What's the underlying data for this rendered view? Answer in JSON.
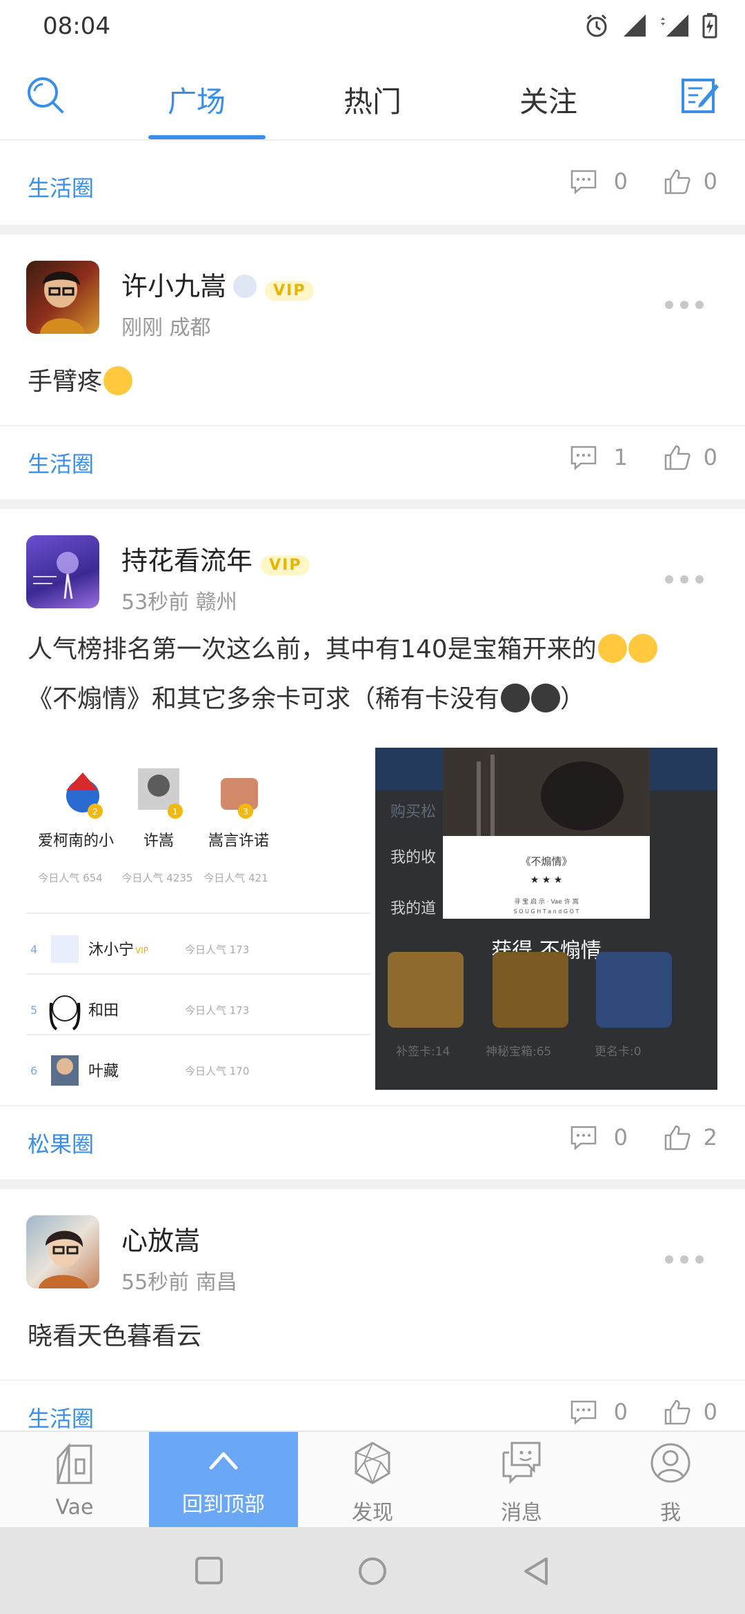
{
  "status_bar": {
    "time": "08:04",
    "network": "4G"
  },
  "top_nav": {
    "tabs": [
      {
        "label": "广场",
        "active": true
      },
      {
        "label": "热门",
        "active": false
      },
      {
        "label": "关注",
        "active": false
      }
    ],
    "search_icon": "search-icon",
    "compose_icon": "compose-icon",
    "accent": "#3b8ee6"
  },
  "first_meta": {
    "circle": "生活圈",
    "comments": "0",
    "likes": "0"
  },
  "posts": [
    {
      "name": "许小九嵩",
      "vip": "VIP",
      "time_location": "刚刚 成都",
      "text": "手臂疼",
      "circle": "生活圈",
      "comments": "1",
      "likes": "0"
    },
    {
      "name": "持花看流年",
      "vip": "VIP",
      "time_location": "53秒前 赣州",
      "text_line1": "人气榜排名第一次这么前，其中有140是宝箱开来的",
      "text_line2": "《不煽情》和其它多余卡可求（稀有卡没有",
      "text_line2_end": "）",
      "circle": "松果圈",
      "comments": "0",
      "likes": "2",
      "ranking_image": {
        "top3": [
          {
            "rank": "2",
            "name": "爱柯南的小",
            "score": "今日人气 654"
          },
          {
            "rank": "1",
            "name": "许嵩",
            "score": "今日人气 4235"
          },
          {
            "rank": "3",
            "name": "嵩言许诺",
            "score": "今日人气 421"
          }
        ],
        "rows": [
          {
            "rank": "4",
            "name": "沐小宁",
            "vip": "VIP",
            "score": "今日人气 173"
          },
          {
            "rank": "5",
            "name": "和田",
            "score": "今日人气 173"
          },
          {
            "rank": "6",
            "name": "叶藏",
            "score": "今日人气 170"
          }
        ]
      },
      "card_image": {
        "card_title": "《不煽情》",
        "stars": "★ ★ ★",
        "card_sub": "寻 宝 启 示 · Vae 许 嵩",
        "card_sub2": "S O U G H T a n d G O T",
        "result": "获得 不煽情",
        "menu1": "购买松",
        "menu2": "我的收",
        "menu3": "我的道",
        "items": [
          "补签卡:14",
          "神秘宝箱:65",
          "更名卡:0"
        ]
      }
    },
    {
      "name": "心放嵩",
      "time_location": "55秒前 南昌",
      "text": "晓看天色暮看云",
      "circle": "生活圈",
      "comments": "0",
      "likes": "0"
    }
  ],
  "bottom_nav": {
    "items": [
      {
        "label": "Vae",
        "icon": "home-icon"
      },
      {
        "label": "回到顶部",
        "icon": "arrow-up-icon"
      },
      {
        "label": "发现",
        "icon": "discover-icon"
      },
      {
        "label": "消息",
        "icon": "message-icon"
      },
      {
        "label": "我",
        "icon": "profile-icon"
      }
    ]
  }
}
